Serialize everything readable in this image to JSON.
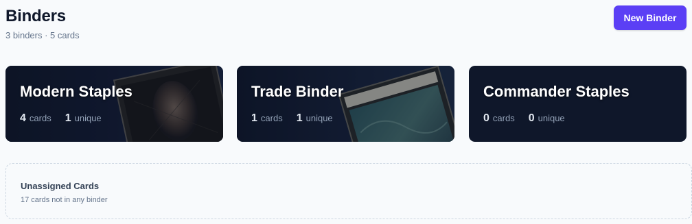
{
  "header": {
    "title": "Binders",
    "subtitle": "3 binders · 5 cards",
    "new_button_label": "New Binder"
  },
  "colors": {
    "accent": "#5b3ff5",
    "card_bg": "#0f172a",
    "page_bg": "#f8fafc"
  },
  "binders": [
    {
      "name": "Modern Staples",
      "cards": "4",
      "cards_label": "cards",
      "unique": "1",
      "unique_label": "unique"
    },
    {
      "name": "Trade Binder",
      "cards": "1",
      "cards_label": "cards",
      "unique": "1",
      "unique_label": "unique"
    },
    {
      "name": "Commander Staples",
      "cards": "0",
      "cards_label": "cards",
      "unique": "0",
      "unique_label": "unique"
    }
  ],
  "unassigned": {
    "title": "Unassigned Cards",
    "subtitle": "17 cards not in any binder"
  }
}
